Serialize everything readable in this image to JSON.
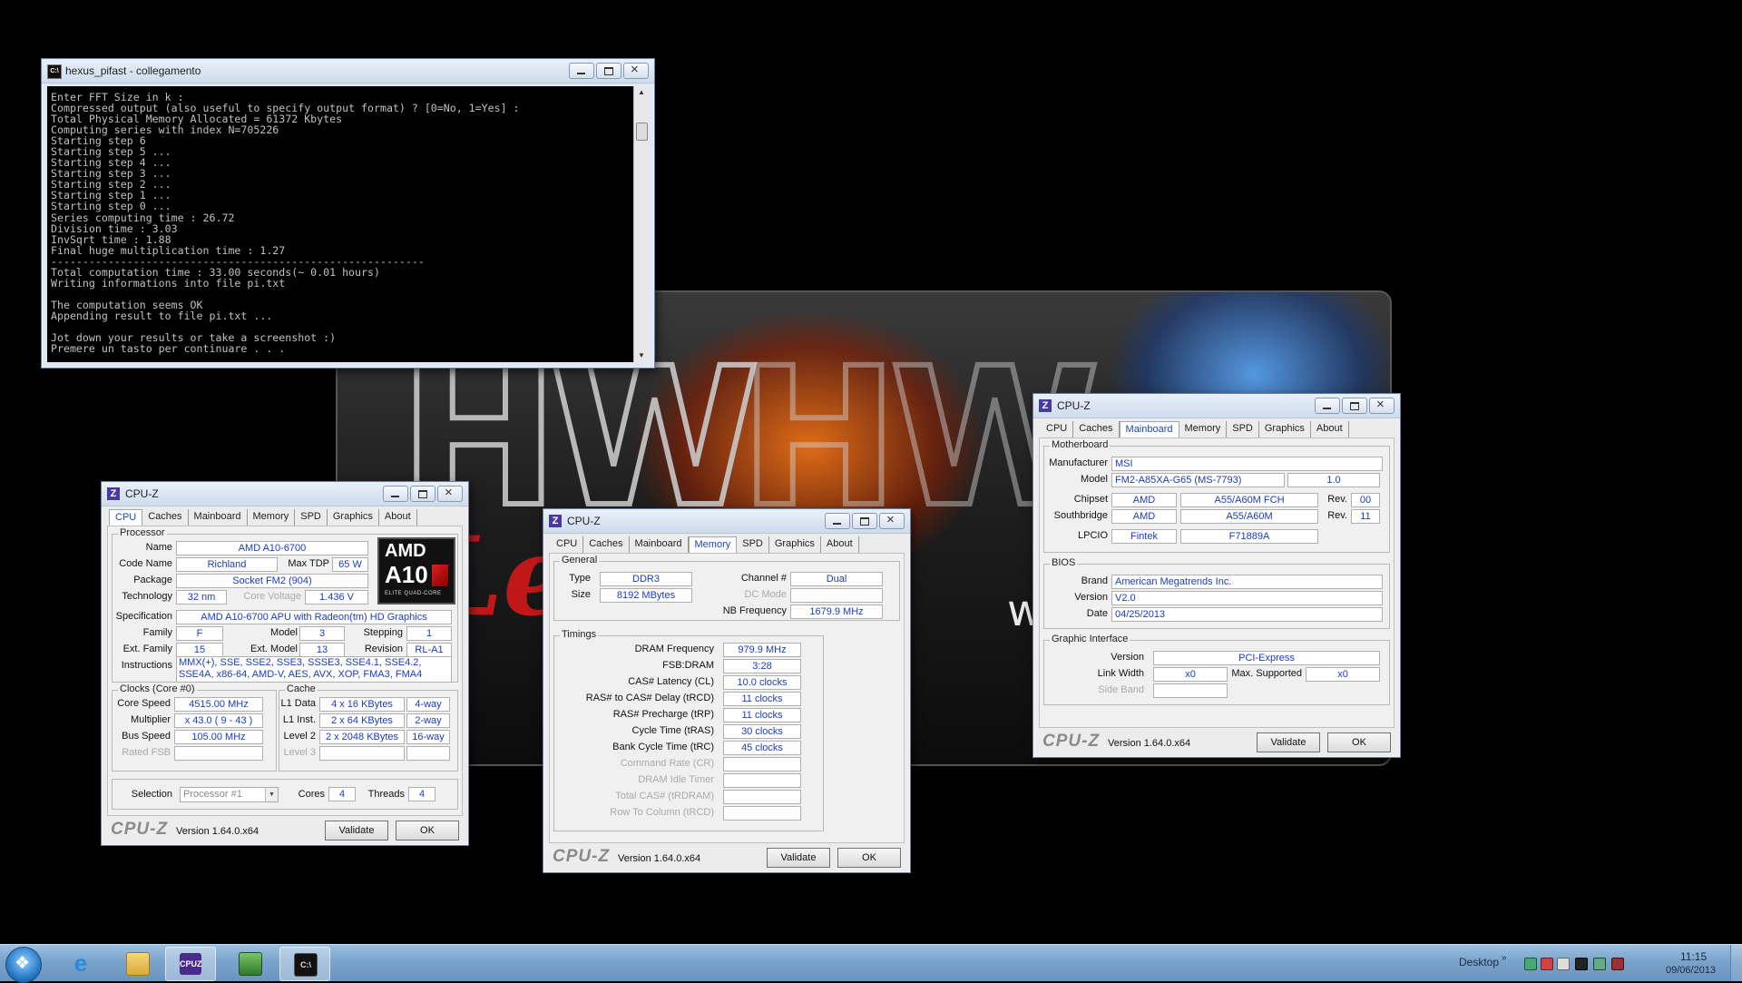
{
  "console": {
    "title": "hexus_pifast - collegamento",
    "lines": [
      "Enter FFT Size in k :",
      "Compressed output (also useful to specify output format) ? [0=No, 1=Yes] :",
      "Total Physical Memory Allocated = 61372 Kbytes",
      "Computing series with index N=705226",
      "Starting step 6",
      "Starting step 5 ...",
      "Starting step 4 ...",
      "Starting step 3 ...",
      "Starting step 2 ...",
      "Starting step 1 ...",
      "Starting step 0 ...",
      "Series computing time : 26.72",
      "Division time : 3.03",
      "InvSqrt time : 1.88",
      "Final huge multiplication time : 1.27",
      "-----------------------------------------------------------",
      "Total computation time : 33.00 seconds(~ 0.01 hours)",
      "Writing informations into file pi.txt",
      "",
      "The computation seems OK",
      "Appending result to file pi.txt ...",
      "",
      "Jot down your results or take a screenshot :)",
      "Premere un tasto per continuare . . ."
    ]
  },
  "cpuz_common": {
    "title": "CPU-Z",
    "tabs": [
      "CPU",
      "Caches",
      "Mainboard",
      "Memory",
      "SPD",
      "Graphics",
      "About"
    ],
    "logo": "CPU-Z",
    "version": "Version 1.64.0.x64",
    "validate": "Validate",
    "ok": "OK"
  },
  "cpu": {
    "processor_title": "Processor",
    "name_label": "Name",
    "name": "AMD A10-6700",
    "codename_label": "Code Name",
    "codename": "Richland",
    "maxtdp_label": "Max TDP",
    "maxtdp": "65 W",
    "package_label": "Package",
    "package": "Socket FM2 (904)",
    "technology_label": "Technology",
    "technology": "32 nm",
    "corevoltage_label": "Core Voltage",
    "corevoltage": "1.436 V",
    "spec_label": "Specification",
    "spec": "AMD A10-6700 APU with Radeon(tm) HD Graphics",
    "family_label": "Family",
    "family": "F",
    "model_label": "Model",
    "model": "3",
    "stepping_label": "Stepping",
    "stepping": "1",
    "extfamily_label": "Ext. Family",
    "extfamily": "15",
    "extmodel_label": "Ext. Model",
    "extmodel": "13",
    "revision_label": "Revision",
    "revision": "RL-A1",
    "instructions_label": "Instructions",
    "instructions": "MMX(+), SSE, SSE2, SSE3, SSSE3, SSE4.1, SSE4.2, SSE4A, x86-64, AMD-V, AES, AVX, XOP, FMA3, FMA4",
    "clocks_title": "Clocks (Core #0)",
    "corespeed_label": "Core Speed",
    "corespeed": "4515.00 MHz",
    "multiplier_label": "Multiplier",
    "multiplier": "x 43.0 ( 9 - 43 )",
    "busspeed_label": "Bus Speed",
    "busspeed": "105.00 MHz",
    "ratedfsb_label": "Rated FSB",
    "cache_title": "Cache",
    "l1data_label": "L1 Data",
    "l1data": "4 x 16 KBytes",
    "l1data_way": "4-way",
    "l1inst_label": "L1 Inst.",
    "l1inst": "2 x 64 KBytes",
    "l1inst_way": "2-way",
    "level2_label": "Level 2",
    "level2": "2 x 2048 KBytes",
    "level2_way": "16-way",
    "level3_label": "Level 3",
    "selection_label": "Selection",
    "selection": "Processor #1",
    "cores_label": "Cores",
    "cores": "4",
    "threads_label": "Threads",
    "threads": "4",
    "amd_logo": {
      "brand": "AMD",
      "model": "A10",
      "sub": "ELITE QUAD-CORE"
    }
  },
  "memory": {
    "general_title": "General",
    "type_label": "Type",
    "type": "DDR3",
    "size_label": "Size",
    "size": "8192 MBytes",
    "channel_label": "Channel #",
    "channel": "Dual",
    "dcmode_label": "DC Mode",
    "nbfreq_label": "NB Frequency",
    "nbfreq": "1679.9 MHz",
    "timings_title": "Timings",
    "dram_label": "DRAM Frequency",
    "dram": "979.9 MHz",
    "fsbdram_label": "FSB:DRAM",
    "fsbdram": "3:28",
    "cl_label": "CAS# Latency (CL)",
    "cl": "10.0 clocks",
    "trcd_label": "RAS# to CAS# Delay (tRCD)",
    "trcd": "11 clocks",
    "trp_label": "RAS# Precharge (tRP)",
    "trp": "11 clocks",
    "tras_label": "Cycle Time (tRAS)",
    "tras": "30 clocks",
    "trc_label": "Bank Cycle Time (tRC)",
    "trc": "45 clocks",
    "cr_label": "Command Rate (CR)",
    "idle_label": "DRAM Idle Timer",
    "trdram_label": "Total CAS# (tRDRAM)",
    "trcdcol_label": "Row To Column (tRCD)"
  },
  "mainboard": {
    "mb_title": "Motherboard",
    "manufacturer_label": "Manufacturer",
    "manufacturer": "MSI",
    "model_label": "Model",
    "model": "FM2-A85XA-G65 (MS-7793)",
    "model_rev": "1.0",
    "chipset_label": "Chipset",
    "chipset_vendor": "AMD",
    "chipset": "A55/A60M FCH",
    "rev_label": "Rev.",
    "chipset_rev": "00",
    "southbridge_label": "Southbridge",
    "sb_vendor": "AMD",
    "sb": "A55/A60M",
    "sb_rev": "11",
    "lpcio_label": "LPCIO",
    "lpcio_vendor": "Fintek",
    "lpcio": "F71889A",
    "bios_title": "BIOS",
    "brand_label": "Brand",
    "brand": "American Megatrends Inc.",
    "version_label": "Version",
    "version": "V2.0",
    "date_label": "Date",
    "date": "04/25/2013",
    "gi_title": "Graphic Interface",
    "gi_version_label": "Version",
    "gi_version": "PCI-Express",
    "linkwidth_label": "Link Width",
    "linkwidth": "x0",
    "maxsupported_label": "Max. Supported",
    "maxsupported": "x0",
    "sideband_label": "Side Band"
  },
  "wallpaper": {
    "letters": "HW",
    "legend": "Legend",
    "ware": "ware C"
  },
  "taskbar": {
    "desktop": "Desktop",
    "time": "11:15",
    "date": "09/06/2013",
    "apps": [
      "windows-start",
      "internet-explorer",
      "file-explorer",
      "cpu-z",
      "gpu-tool",
      "command-prompt"
    ],
    "cpuz_glyph": "CPUZ",
    "cmd_glyph": "C:\\"
  }
}
